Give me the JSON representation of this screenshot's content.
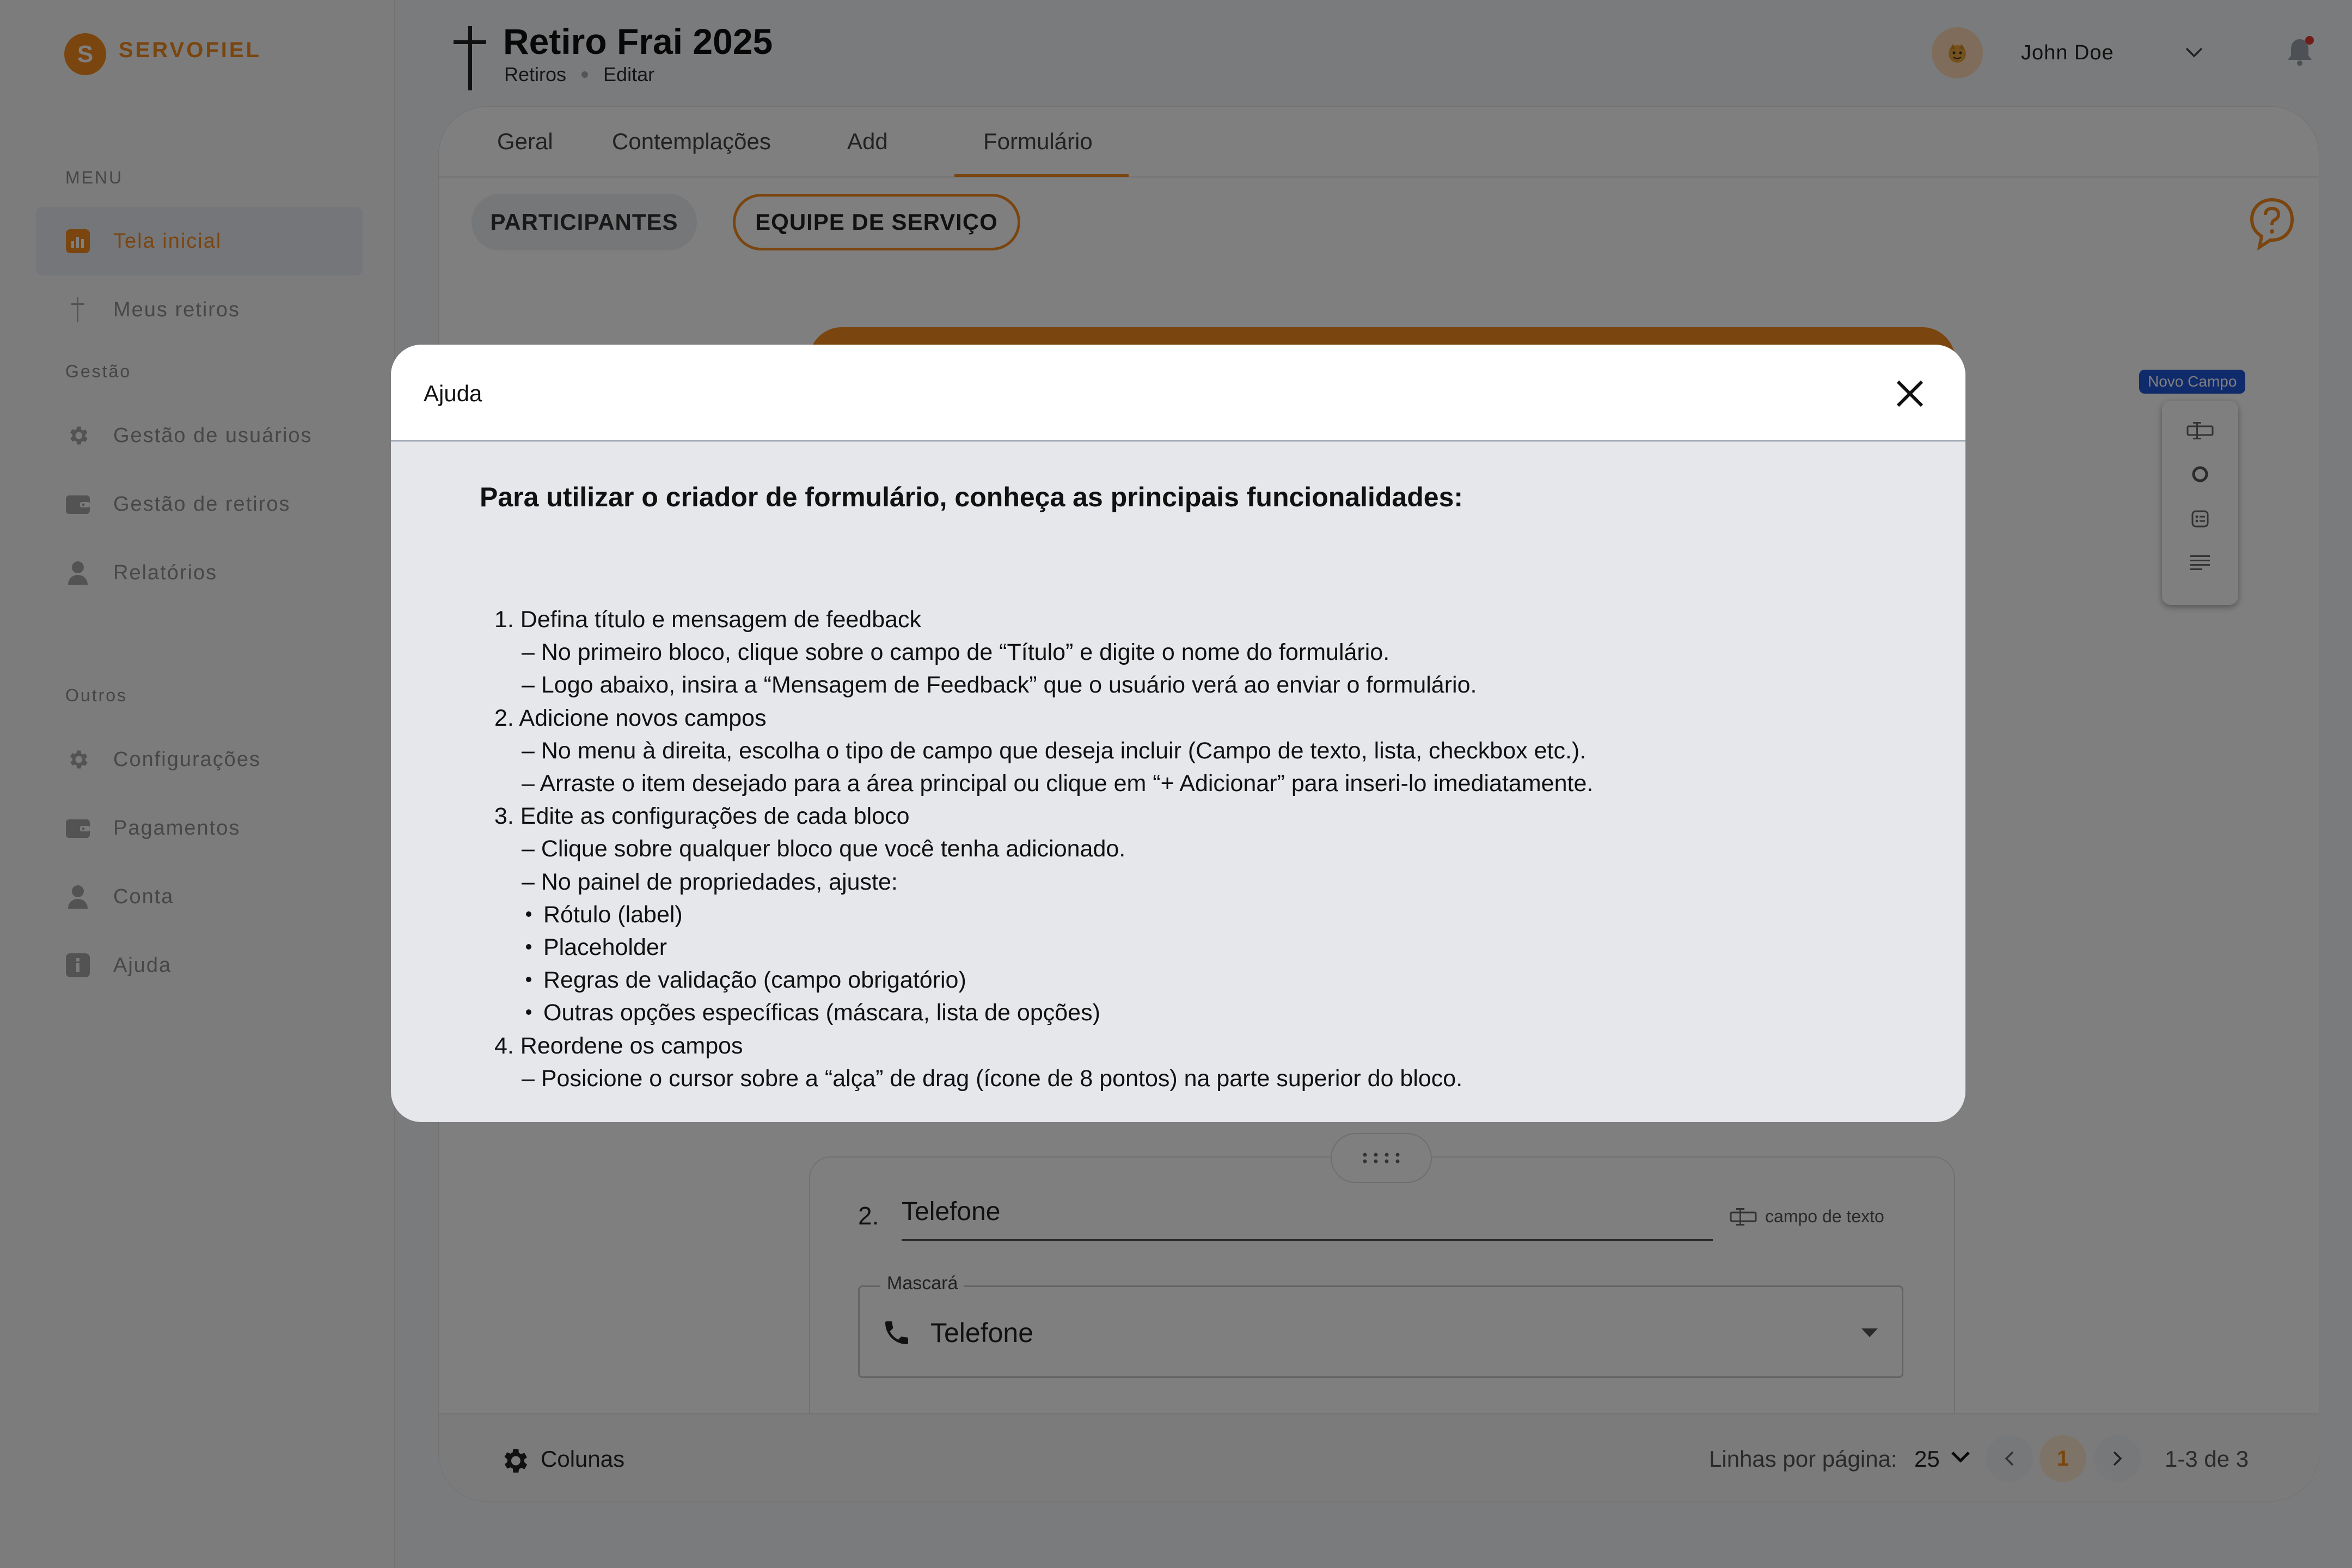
{
  "brand": {
    "initial": "S",
    "name": "SERVOFIEL",
    "accent": "#f58a1f"
  },
  "sidebar": {
    "section_menu": "MENU",
    "section_gestao": "Gestão",
    "section_outros": "Outros",
    "menu_items": [
      {
        "label": "Tela inicial",
        "icon": "chart-icon",
        "active": true
      },
      {
        "label": "Meus retiros",
        "icon": "cross-icon"
      }
    ],
    "gestao_items": [
      {
        "label": "Gestão de usuários",
        "icon": "gear-icon"
      },
      {
        "label": "Gestão de retiros",
        "icon": "wallet-icon"
      },
      {
        "label": "Relatórios",
        "icon": "person-icon"
      }
    ],
    "outros_items": [
      {
        "label": "Configurações",
        "icon": "gear-icon"
      },
      {
        "label": "Pagamentos",
        "icon": "wallet-icon"
      },
      {
        "label": "Conta",
        "icon": "person-icon"
      },
      {
        "label": "Ajuda",
        "icon": "info-icon"
      }
    ]
  },
  "header": {
    "title": "Retiro Frai 2025",
    "breadcrumb": [
      "Retiros",
      "Editar"
    ],
    "user_name": "John Doe"
  },
  "tabs": [
    "Geral",
    "Contemplações",
    "Add",
    "Formulário"
  ],
  "active_tab": "Formulário",
  "toggle_buttons": {
    "participants": "PARTICIPANTES",
    "team": "EQUIPE DE SERVIÇO"
  },
  "new_field_badge": "Novo Campo",
  "field": {
    "number": "2.",
    "label": "Telefone",
    "type_label": "campo de texto",
    "mask_legend": "Mascará",
    "mask_value": "Telefone"
  },
  "footer": {
    "columns_label": "Colunas",
    "rows_per_page_label": "Linhas por página:",
    "rows_per_page_value": "25",
    "current_page": "1",
    "range": "1-3 de 3"
  },
  "modal": {
    "title": "Ajuda",
    "heading": "Para utilizar o criador de formulário, conheça as principais funcionalidades:",
    "lines": [
      {
        "kind": "step",
        "text": "1. Defina título e mensagem de feedback"
      },
      {
        "kind": "sub",
        "text": "– No primeiro bloco, clique sobre o campo de “Título” e digite o nome do formulário."
      },
      {
        "kind": "sub",
        "text": "– Logo abaixo, insira a “Mensagem de Feedback” que o usuário verá ao enviar o formulário."
      },
      {
        "kind": "step",
        "text": "2. Adicione novos campos"
      },
      {
        "kind": "sub",
        "text": "– No menu à direita, escolha o tipo de campo que deseja incluir (Campo de texto, lista, checkbox etc.)."
      },
      {
        "kind": "sub",
        "text": "– Arraste o item desejado para a área principal ou clique em “+ Adicionar” para inseri-lo imediatamente."
      },
      {
        "kind": "step",
        "text": "3. Edite as configurações de cada bloco"
      },
      {
        "kind": "sub",
        "text": "– Clique sobre qualquer bloco que você tenha adicionado."
      },
      {
        "kind": "sub",
        "text": "– No painel de propriedades, ajuste:"
      },
      {
        "kind": "bullet",
        "text": "Rótulo (label)"
      },
      {
        "kind": "bullet",
        "text": "Placeholder"
      },
      {
        "kind": "bullet",
        "text": "Regras de validação (campo obrigatório)"
      },
      {
        "kind": "bullet",
        "text": "Outras opções específicas (máscara, lista de opções)"
      },
      {
        "kind": "step",
        "text": "4. Reordene os campos"
      },
      {
        "kind": "sub",
        "text": "– Posicione o cursor sobre a “alça” de drag (ícone de 8 pontos) na parte superior do bloco."
      }
    ]
  }
}
